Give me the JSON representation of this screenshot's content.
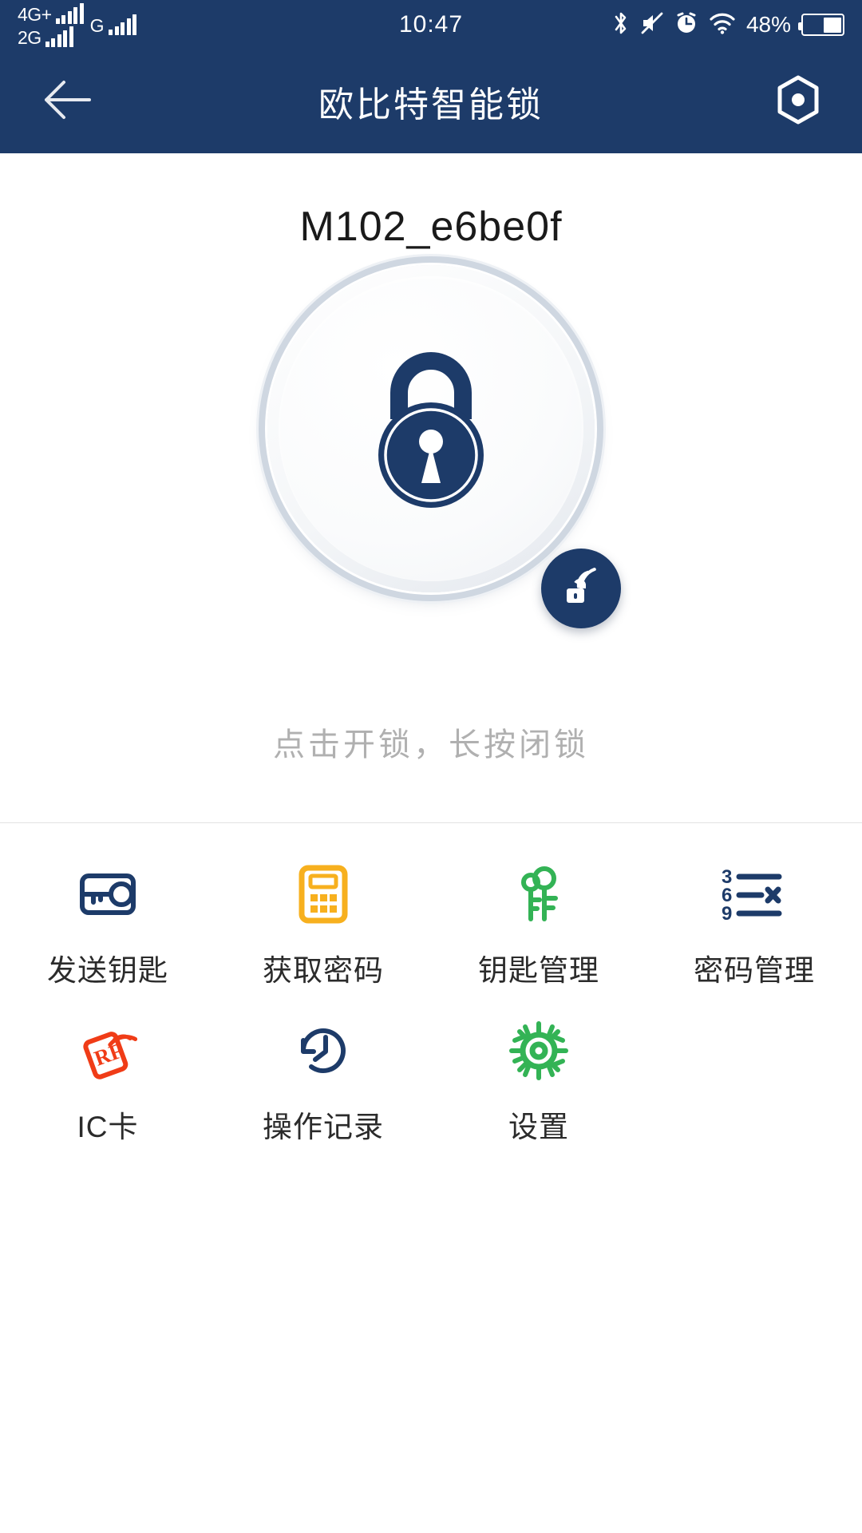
{
  "statusbar": {
    "sim1_network": "4G+",
    "sim2_network": "2G",
    "sim3_network": "G",
    "time": "10:47",
    "bluetooth_icon": "bluetooth-icon",
    "mute_icon": "volume-muted-icon",
    "alarm_icon": "alarm-clock-icon",
    "wifi_icon": "wifi-icon",
    "battery_percent": "48%"
  },
  "header": {
    "back_icon": "back-arrow-icon",
    "title": "欧比特智能锁",
    "action_icon": "hex-nut-icon"
  },
  "device": {
    "name": "M102_e6be0f",
    "lock_icon": "padlock-locked-icon",
    "ble_badge_icon": "wireless-unlock-icon",
    "hint": "点击开锁，长按闭锁"
  },
  "grid": {
    "items": [
      {
        "label": "发送钥匙",
        "icon": "send-key-icon",
        "color": "#1d3b69"
      },
      {
        "label": "获取密码",
        "icon": "calculator-icon",
        "color": "#f7b01e"
      },
      {
        "label": "钥匙管理",
        "icon": "keys-icon",
        "color": "#33b355"
      },
      {
        "label": "密码管理",
        "icon": "password-list-icon",
        "color": "#1d3b69"
      },
      {
        "label": "IC卡",
        "icon": "rf-card-icon",
        "color": "#f03c17"
      },
      {
        "label": "操作记录",
        "icon": "history-clock-icon",
        "color": "#1d3b69"
      },
      {
        "label": "设置",
        "icon": "gear-icon",
        "color": "#33b355"
      }
    ]
  },
  "colors": {
    "brand_navy": "#1d3b69",
    "accent_orange": "#f7b01e",
    "accent_green": "#33b355",
    "accent_red": "#f03c17",
    "hint_gray": "#b0b0b0"
  }
}
